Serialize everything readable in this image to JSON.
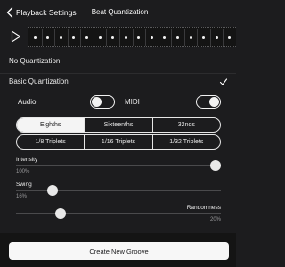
{
  "nav": {
    "back_label": "Playback Settings",
    "back_icon": "chevron-left-icon",
    "title": "Beat Quantization"
  },
  "pattern": {
    "play_icon": "play-icon",
    "dot_count": 16
  },
  "options": {
    "no_quantization": "No Quantization",
    "basic_quantization": "Basic Quantization",
    "selected": "basic_quantization",
    "check_icon": "checkmark-icon"
  },
  "toggles": {
    "audio": {
      "label": "Audio",
      "on": false
    },
    "midi": {
      "label": "MIDI",
      "on": true
    }
  },
  "note_values": {
    "row1": [
      "Eighths",
      "Sixteenths",
      "32nds"
    ],
    "row2": [
      "1/8 Triplets",
      "1/16 Triplets",
      "1/32 Triplets"
    ],
    "selected": "Eighths"
  },
  "sliders": {
    "intensity": {
      "label": "Intensity",
      "value_text": "100%",
      "value": 1.0
    },
    "swing": {
      "label": "Swing",
      "value_text": "16%",
      "value": 0.16
    },
    "randomness": {
      "label": "Randomness",
      "value_text": "20%",
      "value": 0.2
    }
  },
  "footer": {
    "create_label": "Create New Groove"
  },
  "colors": {
    "background": "#1c1c1e",
    "accent": "#f4f4f4",
    "footer_bg": "#141414"
  }
}
